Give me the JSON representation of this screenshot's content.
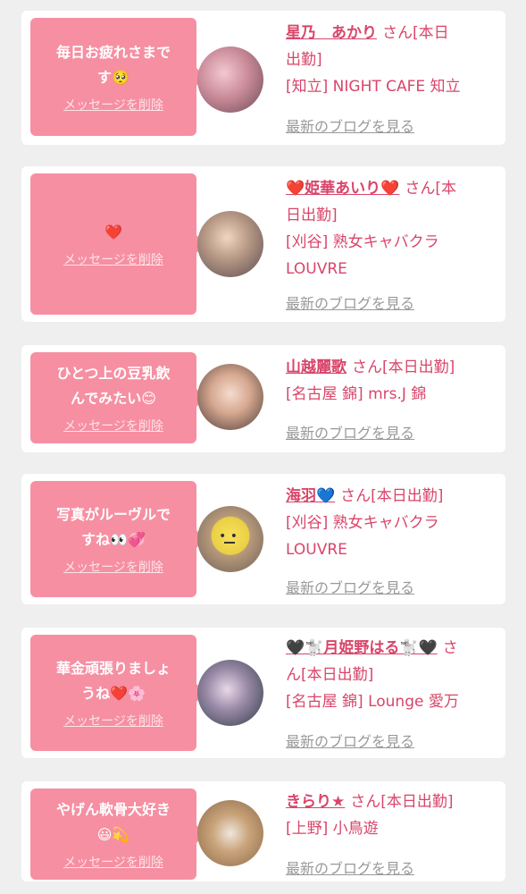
{
  "cards": [
    {
      "message_lines": [
        "毎日お疲れさまで",
        "す🥺"
      ],
      "delete_label": "メッセージを削除",
      "name": "星乃　あかり",
      "san": "さん[本日",
      "info_lines": [
        "出勤]",
        "[知立] NIGHT CAFE 知立"
      ],
      "blog": "最新のブログを見る"
    },
    {
      "message_lines": [
        "❤️"
      ],
      "delete_label": "メッセージを削除",
      "name": "❤️姫華あいり❤️",
      "san": "さん[本",
      "info_lines": [
        "日出勤]",
        "[刈谷] 熟女キャバクラ",
        "LOUVRE"
      ],
      "blog": "最新のブログを見る"
    },
    {
      "message_lines": [
        "ひとつ上の豆乳飲",
        "んでみたい😊"
      ],
      "delete_label": "メッセージを削除",
      "name": "山越麗歌",
      "san": "さん[本日出勤]",
      "info_lines": [
        "[名古屋 錦] mrs.J 錦"
      ],
      "blog": "最新のブログを見る"
    },
    {
      "message_lines": [
        "写真がルーヴルで",
        "すね👀💞"
      ],
      "delete_label": "メッセージを削除",
      "name": "海羽💙",
      "san": "さん[本日出勤]",
      "info_lines": [
        "[刈谷] 熟女キャバクラ",
        "LOUVRE"
      ],
      "blog": "最新のブログを見る"
    },
    {
      "message_lines": [
        "華金頑張りましょ",
        "うね❤️🌸"
      ],
      "delete_label": "メッセージを削除",
      "name": "🖤🐩月姫野はる🐩🖤",
      "san": "さ",
      "info_lines": [
        "ん[本日出勤]",
        "[名古屋 錦] Lounge 愛万"
      ],
      "blog": "最新のブログを見る"
    },
    {
      "message_lines": [
        "やげん軟骨大好き",
        "😃💫"
      ],
      "delete_label": "メッセージを削除",
      "name": "きらり★",
      "san": "さん[本日出勤]",
      "info_lines": [
        "[上野] 小鳥遊"
      ],
      "blog": "最新のブログを見る"
    }
  ],
  "colors": {
    "background": "#efefef",
    "card": "#ffffff",
    "bubble": "#f68fa2",
    "name": "#d9456a",
    "blog_link": "#999999"
  }
}
